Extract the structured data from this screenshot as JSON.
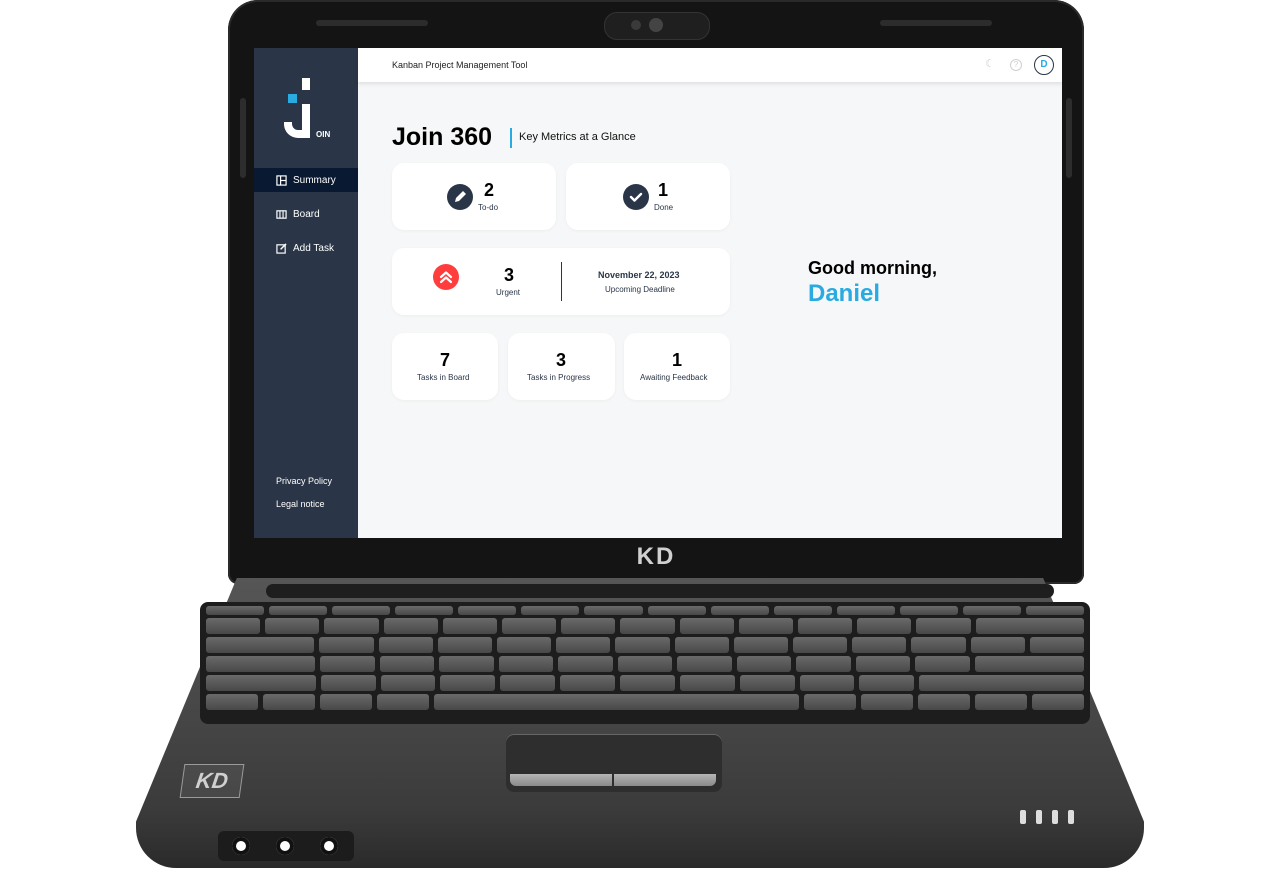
{
  "laptop": {
    "brand": "KD",
    "badge": "KD"
  },
  "app": {
    "topbar_title": "Kanban Project Management Tool",
    "avatar_initial": "D",
    "logo_suffix": "OIN"
  },
  "sidebar": {
    "items": [
      {
        "label": "Summary",
        "icon": "summary-icon",
        "active": true
      },
      {
        "label": "Board",
        "icon": "board-icon",
        "active": false
      },
      {
        "label": "Add Task",
        "icon": "add-task-icon",
        "active": false
      }
    ],
    "footer": {
      "privacy": "Privacy Policy",
      "legal": "Legal notice"
    }
  },
  "summary": {
    "title": "Join 360",
    "subtitle": "Key Metrics at a Glance",
    "todo": {
      "count": "2",
      "label": "To-do"
    },
    "done": {
      "count": "1",
      "label": "Done"
    },
    "urgent": {
      "count": "3",
      "label": "Urgent"
    },
    "deadline": {
      "date": "November 22, 2023",
      "label": "Upcoming Deadline"
    },
    "board": {
      "count": "7",
      "label": "Tasks in Board"
    },
    "progress": {
      "count": "3",
      "label": "Tasks in Progress"
    },
    "feedback": {
      "count": "1",
      "label": "Awaiting Feedback"
    }
  },
  "greeting": {
    "text": "Good morning,",
    "name": "Daniel"
  },
  "colors": {
    "sidebar": "#2a3647",
    "active_nav": "#091931",
    "accent": "#29abe2",
    "urgent": "#ff3d3d"
  }
}
